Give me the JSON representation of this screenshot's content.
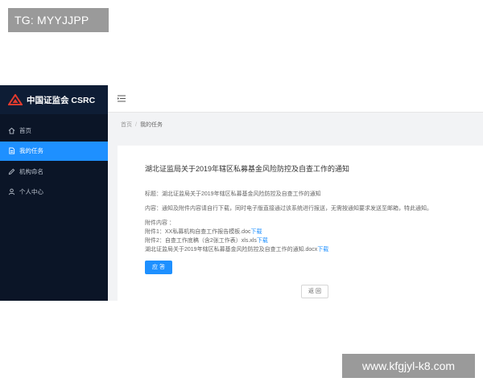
{
  "overlay": {
    "tag_top": "TG: MYYJJPP",
    "tag_bottom": "www.kfgjyl-k8.com"
  },
  "brand": {
    "name": "中国证监会 CSRC",
    "logo_color": "#e23b2e"
  },
  "sidebar": {
    "items": [
      {
        "label": "首页",
        "icon": "home-icon",
        "active": false
      },
      {
        "label": "我的任务",
        "icon": "document-icon",
        "active": true
      },
      {
        "label": "机构命名",
        "icon": "edit-icon",
        "active": false
      },
      {
        "label": "个人中心",
        "icon": "user-icon",
        "active": false
      }
    ]
  },
  "breadcrumb": {
    "home": "首页",
    "separator": "/",
    "current": "我的任务"
  },
  "card": {
    "title": "湖北证监局关于2019年辖区私募基金风险防控及自查工作的通知",
    "subject": "标题：湖北证监局关于2019年辖区私募基金风险防控及自查工作的通知",
    "content": "内容：通知及附件内容请自行下载，同时电子版直接通过该系统进行报送，无需按通知要求发送至邮箱，特此通知。",
    "attachments_label": "附件内容 ：",
    "attachments": [
      {
        "text": "附件1：XX私募机构自查工作报告模板.doc",
        "link": "下载"
      },
      {
        "text": "附件2：自查工作底稿（含2张工作表）xls.xls",
        "link": "下载"
      },
      {
        "text": "湖北证监局关于2019年辖区私募基金风险防控及自查工作的通知.docx",
        "link": "下载"
      }
    ],
    "reply_button": "应 答",
    "back_button": "返 回"
  },
  "colors": {
    "sidebar_bg": "#0b1527",
    "active_item": "#1e90ff",
    "link": "#1e90ff"
  }
}
